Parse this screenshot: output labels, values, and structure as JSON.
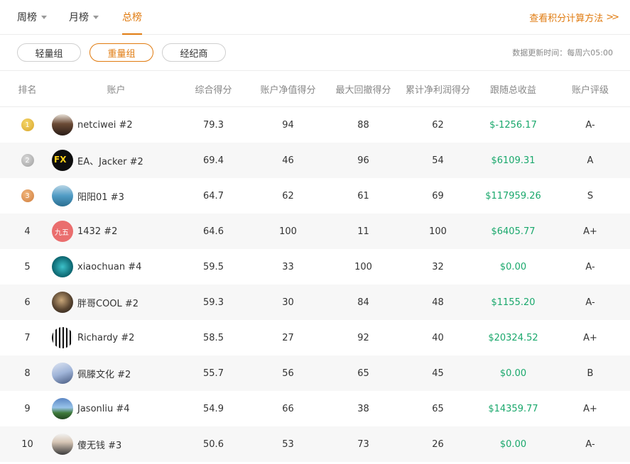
{
  "tabs": [
    {
      "label": "周榜",
      "has_caret": true
    },
    {
      "label": "月榜",
      "has_caret": true
    },
    {
      "label": "总榜",
      "has_caret": false,
      "active": true
    }
  ],
  "calc_link": {
    "label": "查看积分计算方法",
    "chevron": ">>"
  },
  "groups": [
    {
      "label": "轻量组"
    },
    {
      "label": "重量组",
      "active": true
    },
    {
      "label": "经纪商"
    }
  ],
  "update_time": "数据更新时间：每周六05:00",
  "columns": [
    "排名",
    "账户",
    "综合得分",
    "账户净值得分",
    "最大回撤得分",
    "累计净利润得分",
    "跟随总收益",
    "账户评级"
  ],
  "rows": [
    {
      "rank": "1",
      "medal": "gold",
      "account": "netciwei #2",
      "score": "79.3",
      "net_value": "94",
      "drawdown": "88",
      "net_profit": "62",
      "follow_profit": "$-1256.17",
      "rating": "A-"
    },
    {
      "rank": "2",
      "medal": "silver",
      "account": "EA、Jacker #2",
      "avatar_text": "FX",
      "score": "69.4",
      "net_value": "46",
      "drawdown": "96",
      "net_profit": "54",
      "follow_profit": "$6109.31",
      "rating": "A"
    },
    {
      "rank": "3",
      "medal": "bronze",
      "account": "阳阳01 #3",
      "score": "64.7",
      "net_value": "62",
      "drawdown": "61",
      "net_profit": "69",
      "follow_profit": "$117959.26",
      "rating": "S"
    },
    {
      "rank": "4",
      "account": "1432 #2",
      "avatar_text": "九五",
      "score": "64.6",
      "net_value": "100",
      "drawdown": "11",
      "net_profit": "100",
      "follow_profit": "$6405.77",
      "rating": "A+"
    },
    {
      "rank": "5",
      "account": "xiaochuan #4",
      "score": "59.5",
      "net_value": "33",
      "drawdown": "100",
      "net_profit": "32",
      "follow_profit": "$0.00",
      "rating": "A-"
    },
    {
      "rank": "6",
      "account": "胖哥COOL #2",
      "score": "59.3",
      "net_value": "30",
      "drawdown": "84",
      "net_profit": "48",
      "follow_profit": "$1155.20",
      "rating": "A-"
    },
    {
      "rank": "7",
      "account": "Richardy #2",
      "score": "58.5",
      "net_value": "27",
      "drawdown": "92",
      "net_profit": "40",
      "follow_profit": "$20324.52",
      "rating": "A+"
    },
    {
      "rank": "8",
      "account": "佩滕文化 #2",
      "score": "55.7",
      "net_value": "56",
      "drawdown": "65",
      "net_profit": "45",
      "follow_profit": "$0.00",
      "rating": "B"
    },
    {
      "rank": "9",
      "account": "Jasonliu #4",
      "score": "54.9",
      "net_value": "66",
      "drawdown": "38",
      "net_profit": "65",
      "follow_profit": "$14359.77",
      "rating": "A+"
    },
    {
      "rank": "10",
      "account": "傻无钱 #3",
      "score": "50.6",
      "net_value": "53",
      "drawdown": "73",
      "net_profit": "26",
      "follow_profit": "$0.00",
      "rating": "A-"
    }
  ],
  "colors": {
    "accent": "#e07b10",
    "profit": "#1aa86c",
    "stripe": "#f7f7f7"
  }
}
